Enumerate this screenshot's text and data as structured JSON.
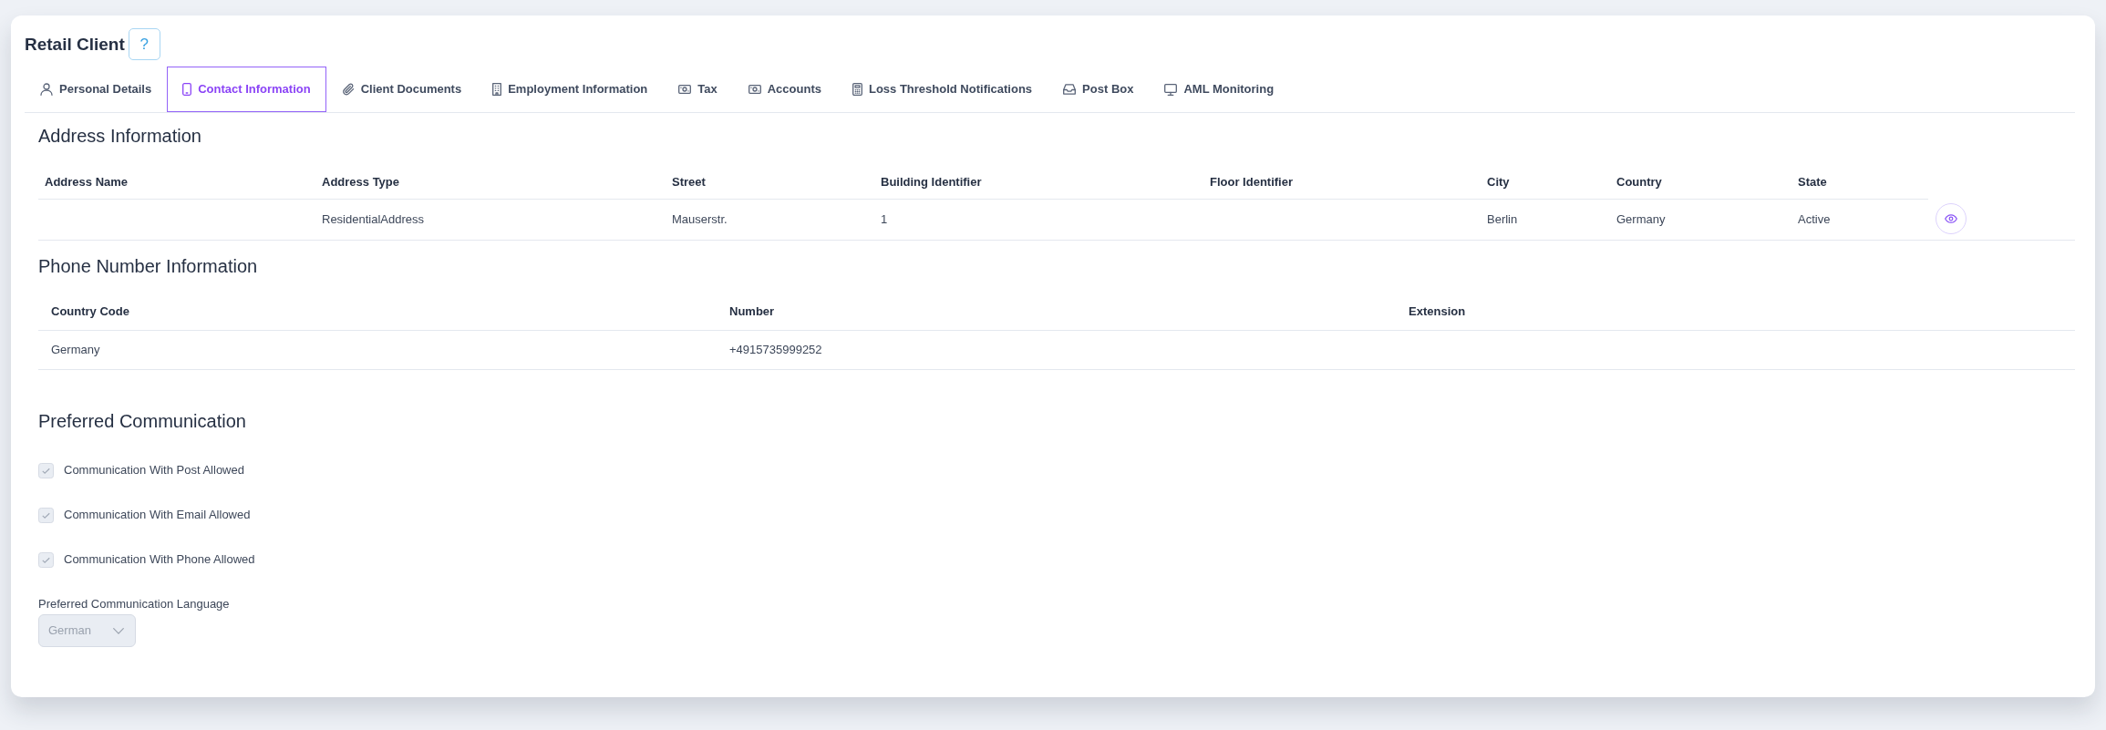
{
  "header": {
    "title": "Retail Client",
    "help_button": "?"
  },
  "tabs": [
    {
      "label": "Personal Details",
      "selected": false
    },
    {
      "label": "Contact Information",
      "selected": true
    },
    {
      "label": "Client Documents",
      "selected": false
    },
    {
      "label": "Employment Information",
      "selected": false
    },
    {
      "label": "Tax",
      "selected": false
    },
    {
      "label": "Accounts",
      "selected": false
    },
    {
      "label": "Loss Threshold Notifications",
      "selected": false
    },
    {
      "label": "Post Box",
      "selected": false
    },
    {
      "label": "AML Monitoring",
      "selected": false
    }
  ],
  "address_information": {
    "title": "Address Information",
    "columns": [
      "Address Name",
      "Address Type",
      "Street",
      "Building Identifier",
      "Floor Identifier",
      "City",
      "Country",
      "State"
    ],
    "rows": [
      {
        "cells": [
          null,
          "ResidentialAddress",
          "Mauserstr.",
          "1",
          null,
          "Berlin",
          "Germany",
          "Active"
        ]
      }
    ]
  },
  "phone_number_information": {
    "title": "Phone Number Information",
    "columns": [
      "Country Code",
      "Number",
      "Extension"
    ],
    "rows": [
      {
        "cells": [
          "Germany",
          "+4915735999252",
          null
        ]
      }
    ]
  },
  "preferred_communication": {
    "title": "Preferred Communication",
    "options": [
      {
        "label": "Communication With Post Allowed",
        "checked": true,
        "disabled": true
      },
      {
        "label": "Communication With Email Allowed",
        "checked": true,
        "disabled": true
      },
      {
        "label": "Communication With Phone Allowed",
        "checked": true,
        "disabled": true
      }
    ],
    "language": {
      "label": "Preferred Communication Language",
      "value": "German",
      "disabled": true
    }
  }
}
